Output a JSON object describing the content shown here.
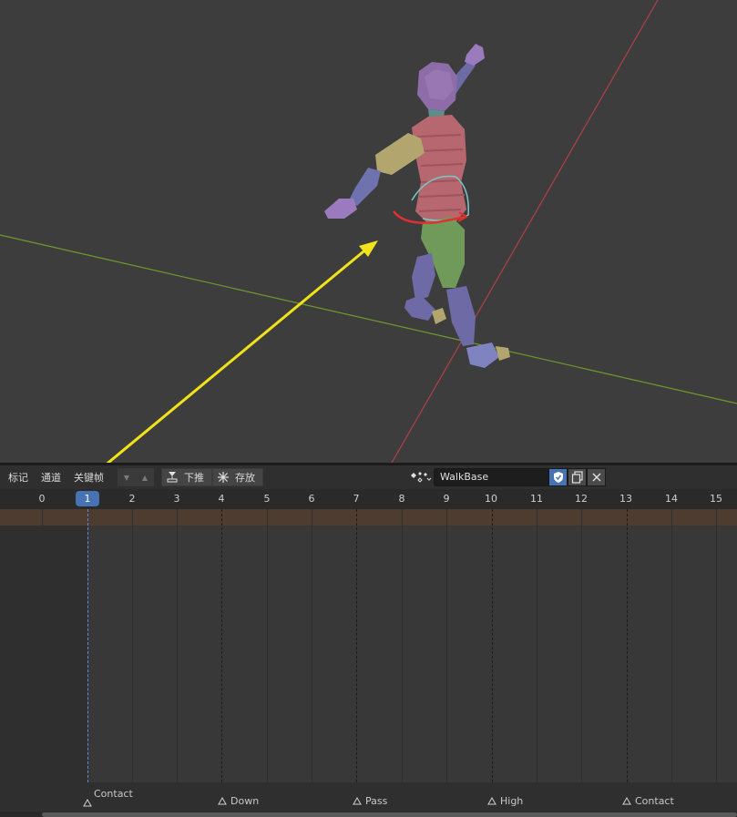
{
  "menu": {
    "marker": "标记",
    "channel": "通道",
    "key": "关键帧"
  },
  "toolbar": {
    "push_down": "下推",
    "stash": "存放"
  },
  "action": {
    "name": "WalkBase"
  },
  "timeline": {
    "current_frame": "1",
    "frame_labels": [
      "0",
      "2",
      "3",
      "4",
      "5",
      "6",
      "7",
      "8",
      "9",
      "10",
      "11",
      "12",
      "13",
      "14",
      "15"
    ]
  },
  "markers": [
    {
      "label": "Contact",
      "frame": 1
    },
    {
      "label": "Down",
      "frame": 4
    },
    {
      "label": "Pass",
      "frame": 7
    },
    {
      "label": "High",
      "frame": 10
    },
    {
      "label": "Contact",
      "frame": 13
    }
  ],
  "colors": {
    "accent": "#4772b3",
    "annotation_arrow": "#f2e21a",
    "x_axis": "#b24048",
    "y_axis": "#6f9a2b"
  }
}
